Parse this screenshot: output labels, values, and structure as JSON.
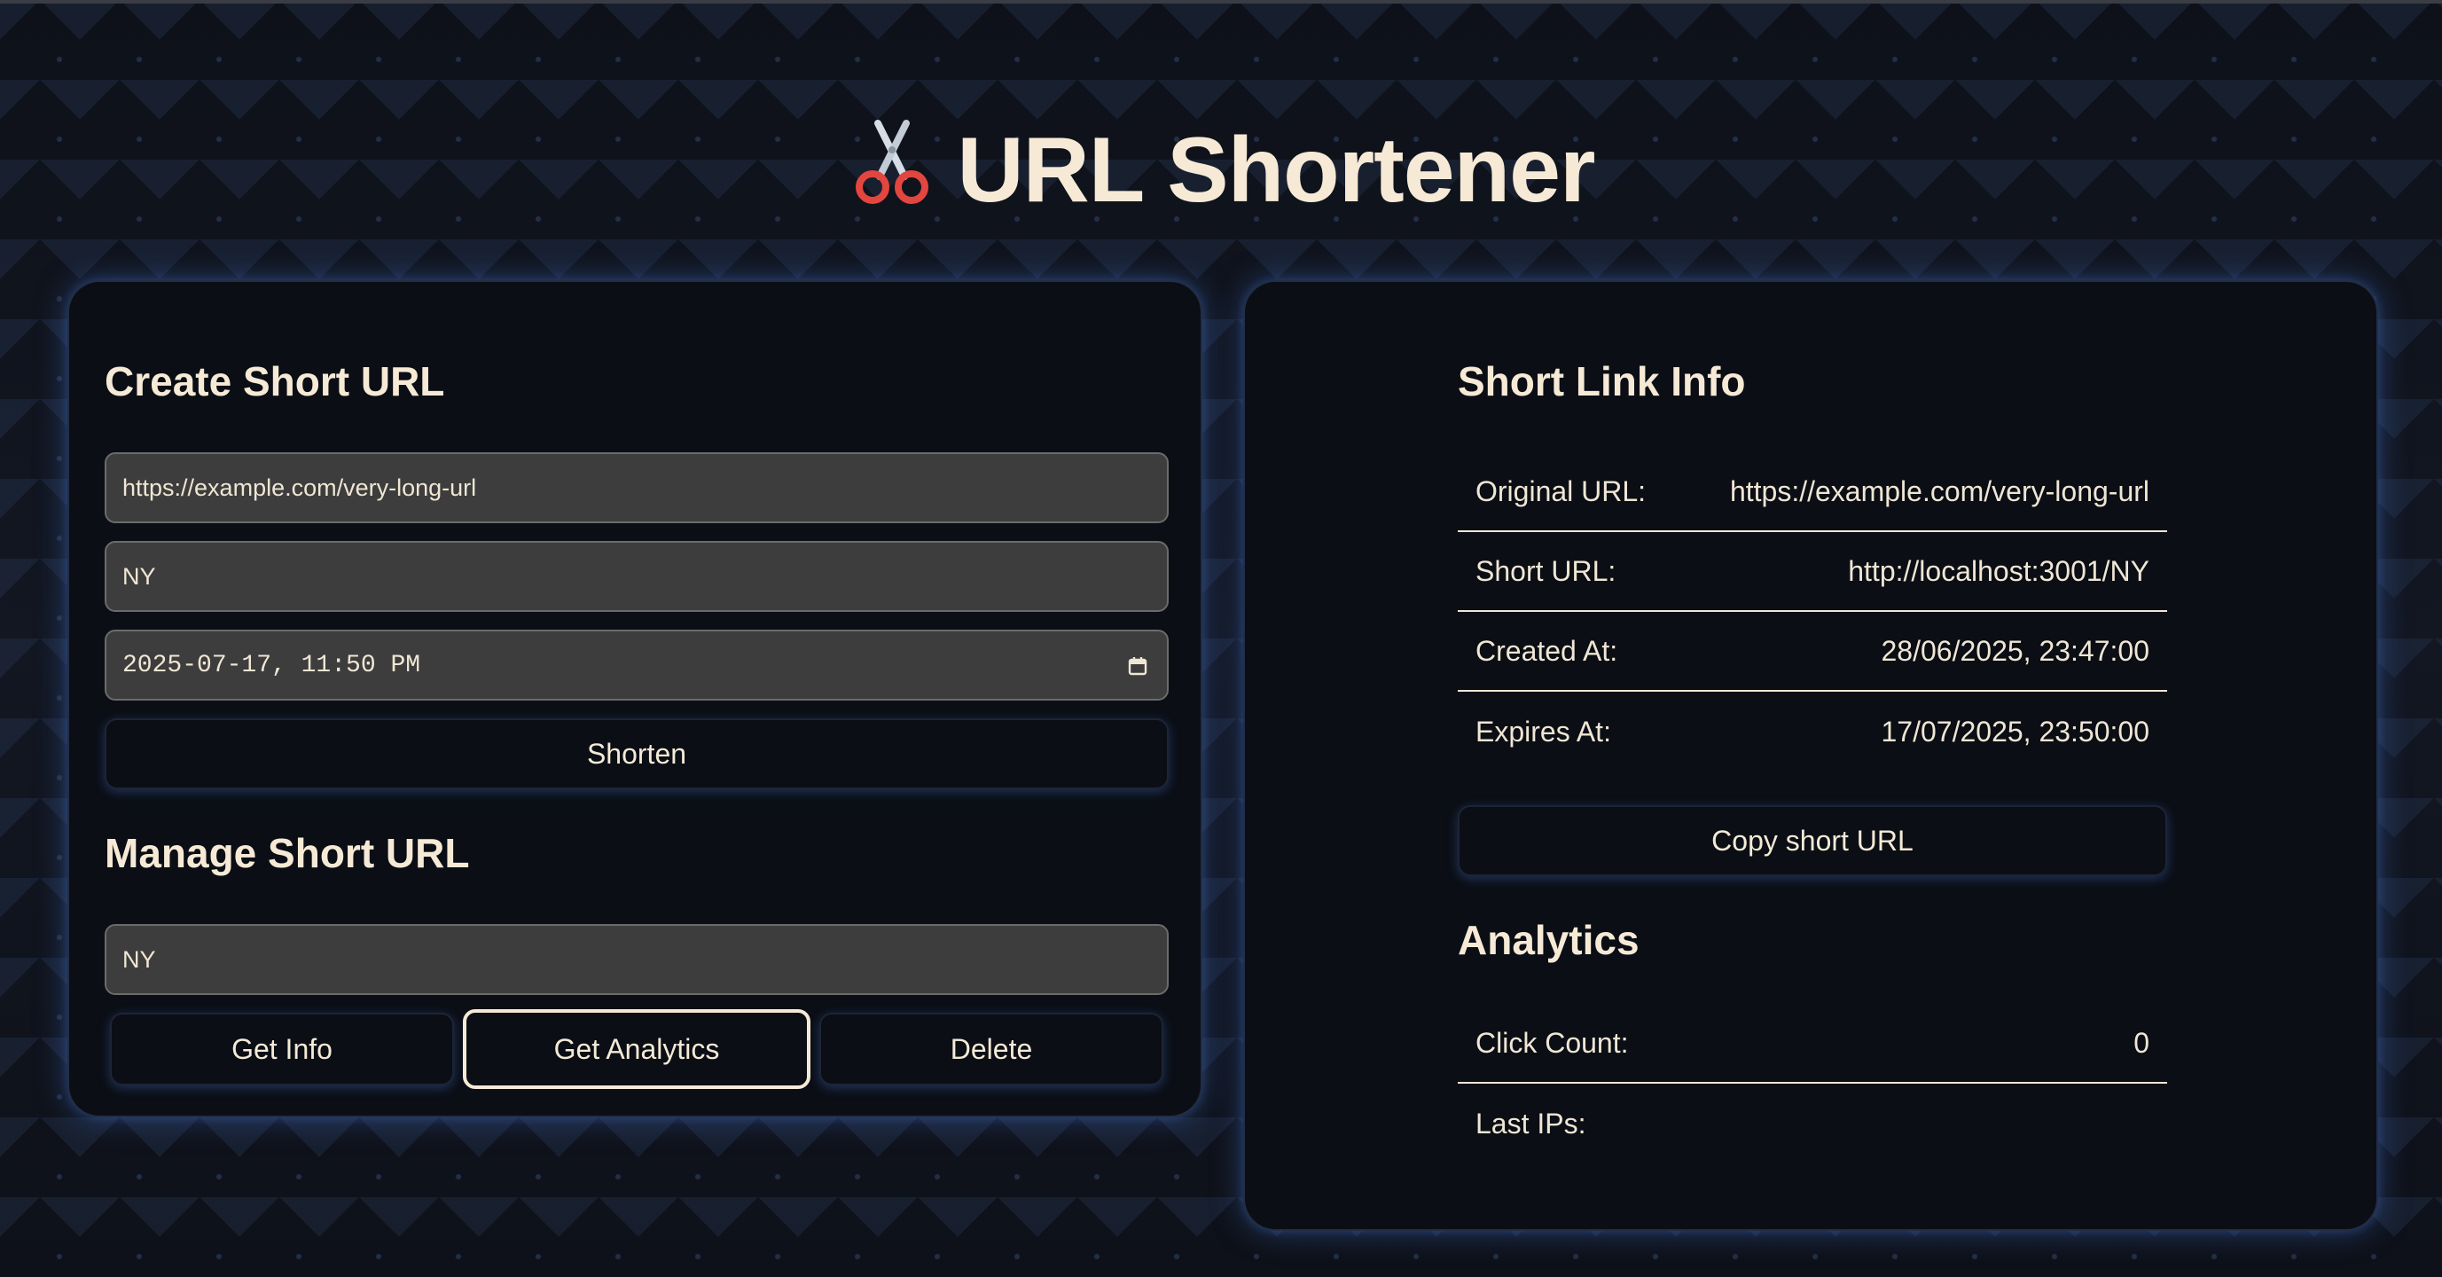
{
  "app": {
    "title": "URL Shortener",
    "title_icon": "scissors-icon"
  },
  "create": {
    "heading": "Create Short URL",
    "url_value": "https://example.com/very-long-url",
    "shortcode_value": "NY",
    "expiry_value": "2025-07-17, 11:50 PM",
    "shorten_label": "Shorten"
  },
  "manage": {
    "heading": "Manage Short URL",
    "code_value": "NY",
    "get_info_label": "Get Info",
    "get_analytics_label": "Get Analytics",
    "delete_label": "Delete"
  },
  "info": {
    "heading": "Short Link Info",
    "rows": [
      {
        "label": "Original URL:",
        "value": "https://example.com/very-long-url"
      },
      {
        "label": "Short URL:",
        "value": "http://localhost:3001/NY"
      },
      {
        "label": "Created At:",
        "value": "28/06/2025, 23:47:00"
      },
      {
        "label": "Expires At:",
        "value": "17/07/2025, 23:50:00"
      }
    ],
    "copy_label": "Copy short URL"
  },
  "analytics": {
    "heading": "Analytics",
    "rows": [
      {
        "label": "Click Count:",
        "value": "0"
      },
      {
        "label": "Last IPs:",
        "value": ""
      }
    ]
  },
  "colors": {
    "background": "#0f131d",
    "card": "#0b0e15",
    "text": "#f5ead7",
    "input": "#3d3d3d",
    "glow": "#3c64b4"
  }
}
